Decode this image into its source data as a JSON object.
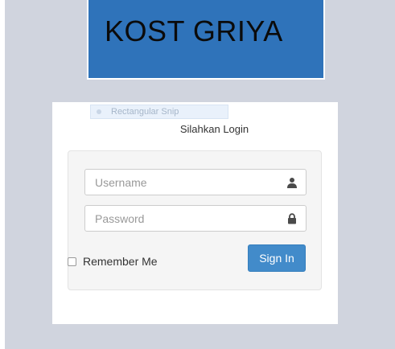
{
  "header": {
    "title": "KOST GRIYA"
  },
  "snip_overlay": {
    "label": "Rectangular Snip"
  },
  "login": {
    "heading": "Silahkan Login",
    "username": {
      "placeholder": "Username",
      "value": "",
      "icon": "user-icon"
    },
    "password": {
      "placeholder": "Password",
      "value": "",
      "icon": "lock-icon"
    },
    "remember_label": "Remember Me",
    "remember_checked": false,
    "signin_label": "Sign In"
  },
  "colors": {
    "page_background": "#d0d4de",
    "header_background": "#2f73ba",
    "button_primary": "#428bca"
  }
}
